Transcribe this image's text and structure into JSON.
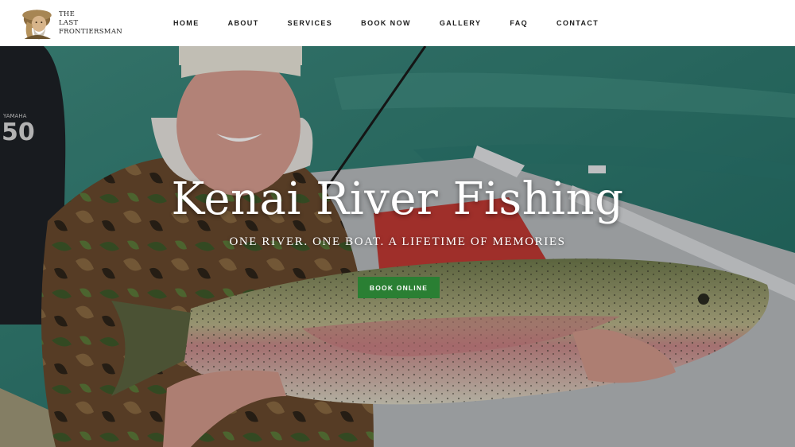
{
  "logo": {
    "line1": "THE",
    "line2": "LAST",
    "line3": "FRONTIERSMAN"
  },
  "nav": {
    "items": [
      {
        "label": "HOME"
      },
      {
        "label": "ABOUT"
      },
      {
        "label": "SERVICES"
      },
      {
        "label": "BOOK NOW"
      },
      {
        "label": "GALLERY"
      },
      {
        "label": "FAQ"
      },
      {
        "label": "CONTACT"
      }
    ]
  },
  "hero": {
    "title": "Kenai River Fishing",
    "subtitle": "ONE RIVER. ONE BOAT. A LIFETIME OF MEMORIES",
    "button_label": "BOOK ONLINE",
    "motor_label": "50",
    "motor_brand": "YAMAHA"
  },
  "colors": {
    "accent_green": "#2a7f33",
    "river_teal": "#2e7a72",
    "nav_text": "#1d1d1d"
  },
  "icons": {
    "logo_mark": "frontiersman-portrait-icon"
  }
}
